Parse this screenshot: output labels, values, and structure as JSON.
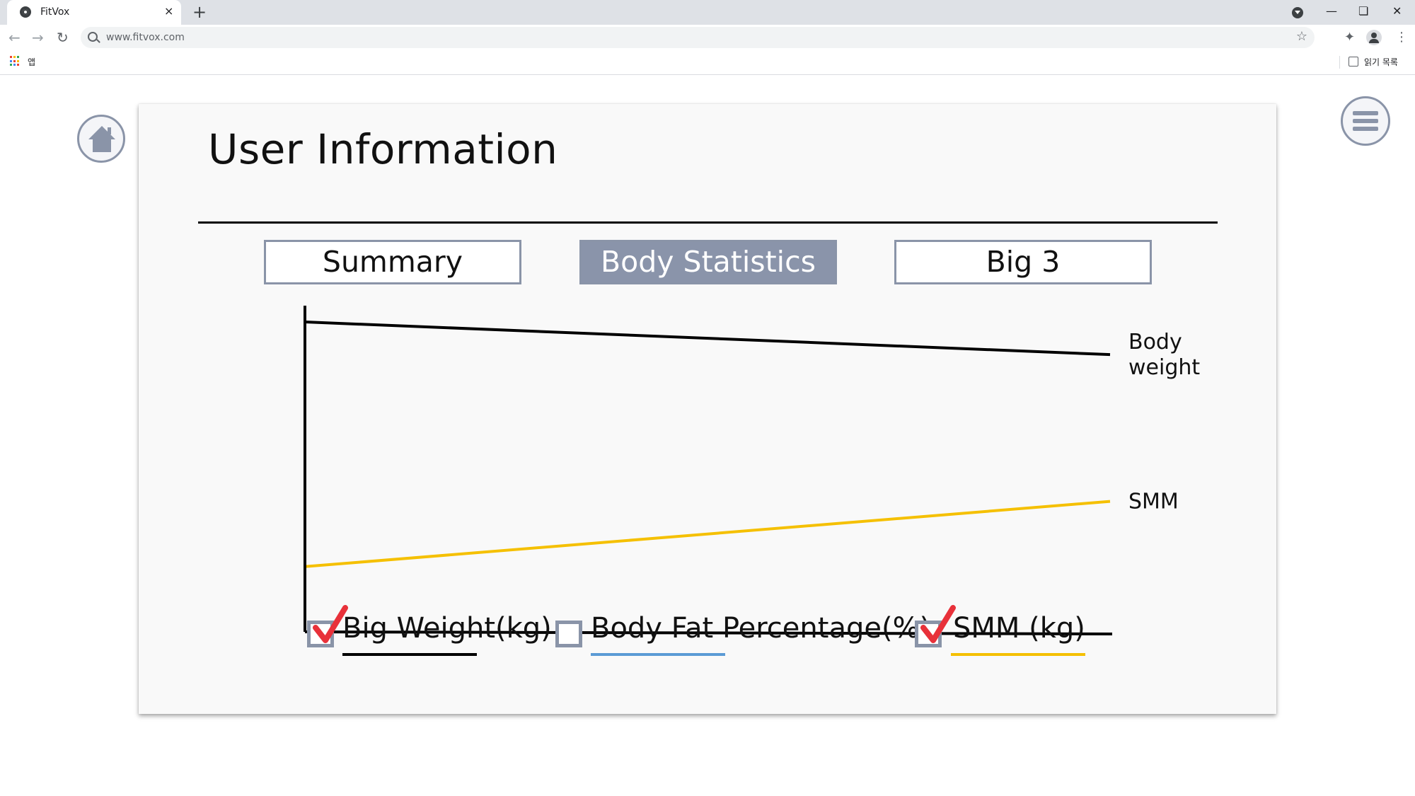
{
  "browser": {
    "tab_title": "FitVox",
    "tab_close": "×",
    "new_tab": "+",
    "url": "www.fitvox.com",
    "bookmarks_apps_label": "앱",
    "reading_list_label": "읽기 목록",
    "icons": [
      "favicon-icon",
      "close-icon",
      "plus-icon",
      "back-icon",
      "forward-icon",
      "reload-icon",
      "search-icon",
      "star-icon",
      "extensions-icon",
      "profile-icon",
      "more-icon",
      "apps-icon",
      "reading-list-icon",
      "minimize-icon",
      "restore-icon",
      "window-close-icon"
    ]
  },
  "page": {
    "title": "User Information",
    "tabs": [
      {
        "label": "Summary",
        "active": false
      },
      {
        "label": "Body Statistics",
        "active": true
      },
      {
        "label": "Big 3",
        "active": false
      }
    ],
    "colors": {
      "accent": "#8a94aa",
      "body_weight_series": "#000000",
      "body_fat_series": "#5b9bd5",
      "smm_series": "#f5c000",
      "check": "#e8313a"
    }
  },
  "chart_data": {
    "type": "line",
    "title": "",
    "xlabel": "",
    "ylabel": "",
    "x": [
      0,
      1
    ],
    "series": [
      {
        "name": "Body weight",
        "label": [
          "Body",
          "weight"
        ],
        "color": "#000000",
        "values": [
          0.95,
          0.85
        ]
      },
      {
        "name": "SMM",
        "label": [
          "SMM"
        ],
        "color": "#f5c000",
        "values": [
          0.2,
          0.4
        ]
      }
    ],
    "ylim": [
      0,
      1
    ],
    "grid": false
  },
  "legend": [
    {
      "label": "Big Weight(kg)",
      "checked": true,
      "underline_color": "#000000"
    },
    {
      "label": "Body Fat Percentage(%)",
      "checked": false,
      "underline_color": "#5b9bd5"
    },
    {
      "label": "SMM (kg)",
      "checked": true,
      "underline_color": "#f5c000"
    }
  ]
}
